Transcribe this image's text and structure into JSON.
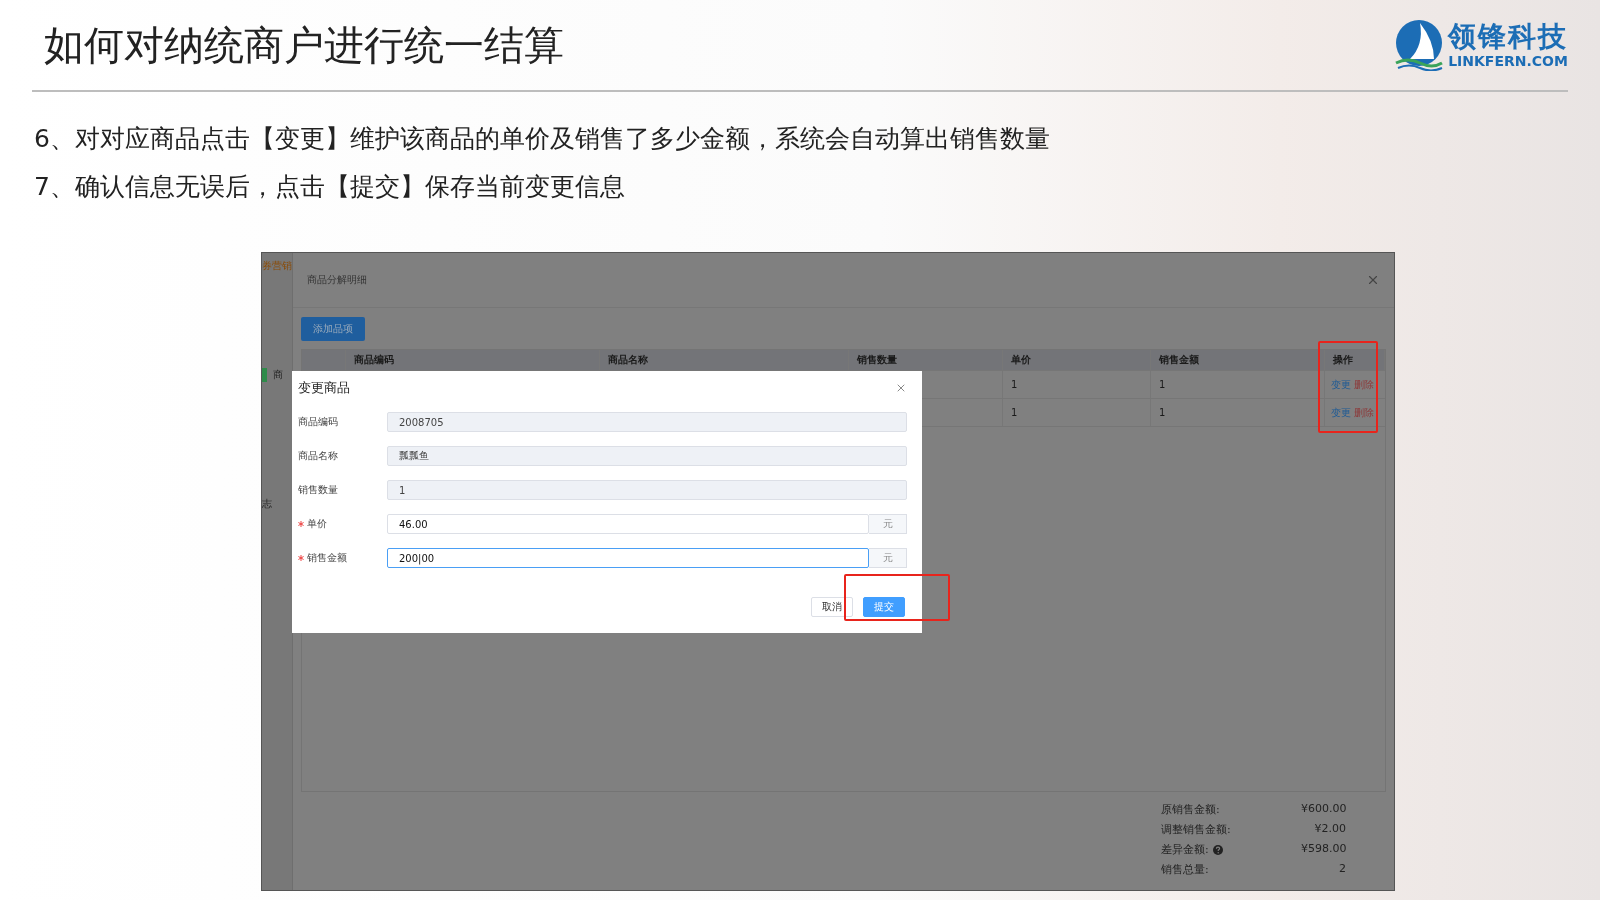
{
  "slide": {
    "title": "如何对纳统商户进行统一结算",
    "logo": {
      "name": "领锋科技",
      "domain": "LINKFERN.COM"
    },
    "steps": [
      "6、对对应商品点击【变更】维护该商品的单价及销售了多少金额，系统会自动算出销售数量",
      "7、确认信息无误后，点击【提交】保存当前变更信息"
    ]
  },
  "screenshot": {
    "sidebar_fragments": [
      {
        "label": "券营销",
        "selected": false
      },
      {
        "label": "商",
        "selected": true
      },
      {
        "label": "志",
        "selected": false
      }
    ],
    "panel": {
      "title": "商品分解明细",
      "add_button": "添加品项",
      "table": {
        "columns": [
          "商品编码",
          "商品名称",
          "销售数量",
          "单价",
          "销售金额",
          "操作"
        ],
        "rows": [
          {
            "unit_price": "1",
            "sales_amount": "1",
            "actions": [
              {
                "label": "变更",
                "kind": "edit"
              },
              {
                "label": "删除",
                "kind": "delete"
              }
            ]
          },
          {
            "unit_price": "1",
            "sales_amount": "1",
            "actions": [
              {
                "label": "变更",
                "kind": "edit"
              },
              {
                "label": "删除",
                "kind": "delete"
              }
            ]
          }
        ]
      },
      "summary": [
        {
          "label": "原销售金额:",
          "value": "¥600.00",
          "help": false
        },
        {
          "label": "调整销售金额:",
          "value": "¥2.00",
          "help": false
        },
        {
          "label": "差异金额:",
          "value": "¥598.00",
          "help": true
        },
        {
          "label": "销售总量:",
          "value": "2",
          "help": false
        }
      ]
    },
    "modal": {
      "title": "变更商品",
      "fields": [
        {
          "label": "商品编码",
          "value": "2008705",
          "required": false,
          "disabled": true,
          "focused": false
        },
        {
          "label": "商品名称",
          "value": "瓢瓢鱼",
          "required": false,
          "disabled": true,
          "focused": false
        },
        {
          "label": "销售数量",
          "value": "1",
          "required": false,
          "disabled": true,
          "focused": false
        },
        {
          "label": "单价",
          "value": "46.00",
          "required": true,
          "disabled": false,
          "focused": false,
          "suffix": "元"
        },
        {
          "label": "销售金额",
          "value": "200|00",
          "required": true,
          "disabled": false,
          "focused": true,
          "suffix": "元"
        }
      ],
      "buttons": [
        {
          "label": "取消",
          "kind": "default"
        },
        {
          "label": "提交",
          "kind": "primary"
        }
      ]
    }
  }
}
